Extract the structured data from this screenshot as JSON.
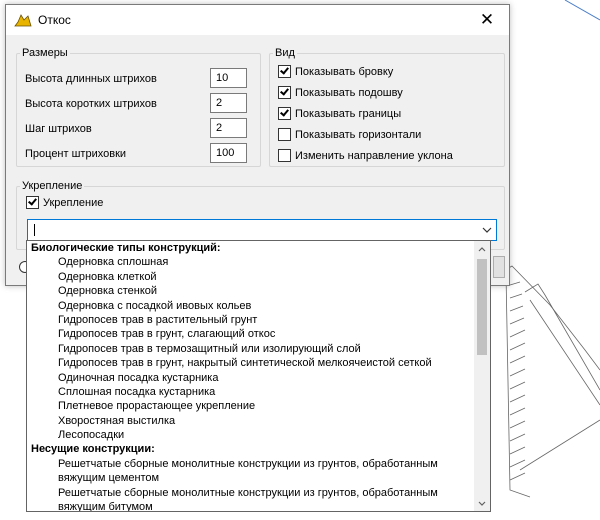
{
  "window": {
    "title": "Откос",
    "close_label": "✕"
  },
  "sizes": {
    "legend": "Размеры",
    "fields": [
      {
        "label": "Высота длинных штрихов",
        "value": "10"
      },
      {
        "label": "Высота коротких штрихов",
        "value": "2"
      },
      {
        "label": "Шаг штрихов",
        "value": "2"
      },
      {
        "label": "Процент штриховки",
        "value": "100"
      }
    ]
  },
  "view": {
    "legend": "Вид",
    "options": [
      {
        "label": "Показывать бровку",
        "checked": true
      },
      {
        "label": "Показывать подошву",
        "checked": true
      },
      {
        "label": "Показывать границы",
        "checked": true
      },
      {
        "label": "Показывать горизонтали",
        "checked": false
      },
      {
        "label": "Изменить направление уклона",
        "checked": false
      }
    ]
  },
  "reinforcement": {
    "legend": "Укрепление",
    "checkbox_label": "Укрепление",
    "checked": true,
    "combo_value": ""
  },
  "dropdown": {
    "items": [
      {
        "text": "Биологические типы конструкций:",
        "kind": "cat"
      },
      {
        "text": "Одерновка сплошная",
        "kind": "item"
      },
      {
        "text": "Одерновка клеткой",
        "kind": "item"
      },
      {
        "text": "Одерновка стенкой",
        "kind": "item"
      },
      {
        "text": "Одерновка с посадкой ивовых кольев",
        "kind": "item"
      },
      {
        "text": "Гидропосев трав в растительный грунт",
        "kind": "item"
      },
      {
        "text": "Гидропосев трав в грунт, слагающий откос",
        "kind": "item"
      },
      {
        "text": "Гидропосев трав в термозащитный или изолирующий слой",
        "kind": "item"
      },
      {
        "text": "Гидропосев трав в грунт, накрытый синтетической мелкоячеистой сеткой",
        "kind": "item"
      },
      {
        "text": "Одиночная посадка кустарника",
        "kind": "item"
      },
      {
        "text": "Сплошная посадка кустарника",
        "kind": "item"
      },
      {
        "text": "Плетневое прорастающее укрепление",
        "kind": "item"
      },
      {
        "text": "Хворостяная выстилка",
        "kind": "item"
      },
      {
        "text": "Лесопосадки",
        "kind": "item"
      },
      {
        "text": "Несущие конструкции:",
        "kind": "cat"
      },
      {
        "text": "Решетчатые сборные монолитные конструкции из грунтов, обработанным вяжущим цементом",
        "kind": "wrap"
      },
      {
        "text": "Решетчатые сборные монолитные конструкции из грунтов, обработанным вяжущим битумом",
        "kind": "wrap"
      }
    ]
  },
  "colors": {
    "accent": "#0078d7",
    "dialog_bg": "#f0f0f0",
    "icon_yellow": "#e8b400"
  }
}
